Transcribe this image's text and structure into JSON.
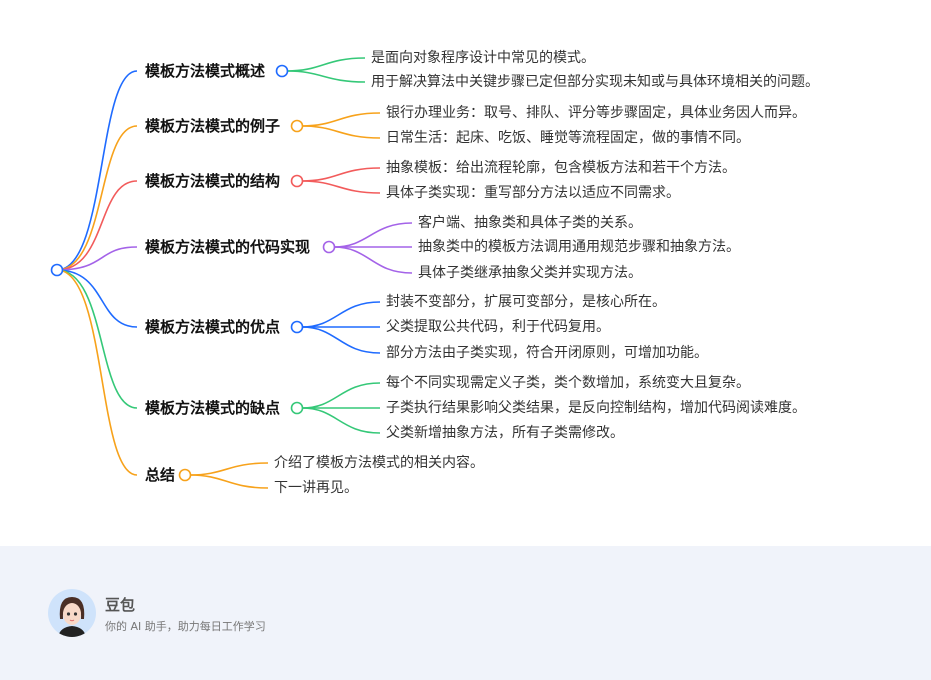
{
  "colors": {
    "blue": "#1f6bff",
    "orange": "#f7a21b",
    "red": "#f25b5b",
    "purple": "#a463e8",
    "green": "#35c878"
  },
  "branches": [
    {
      "label": "模板方法模式概述",
      "color": "blue",
      "leafColor": "green",
      "leaves": [
        "是面向对象程序设计中常见的模式。",
        "用于解决算法中关键步骤已定但部分实现未知或与具体环境相关的问题。"
      ]
    },
    {
      "label": "模板方法模式的例子",
      "color": "orange",
      "leafColor": "orange",
      "leaves": [
        "银行办理业务：取号、排队、评分等步骤固定，具体业务因人而异。",
        "日常生活：起床、吃饭、睡觉等流程固定，做的事情不同。"
      ]
    },
    {
      "label": "模板方法模式的结构",
      "color": "red",
      "leafColor": "red",
      "leaves": [
        "抽象模板：给出流程轮廓，包含模板方法和若干个方法。",
        "具体子类实现：重写部分方法以适应不同需求。"
      ]
    },
    {
      "label": "模板方法模式的代码实现",
      "color": "purple",
      "leafColor": "purple",
      "leaves": [
        "客户端、抽象类和具体子类的关系。",
        "抽象类中的模板方法调用通用规范步骤和抽象方法。",
        "具体子类继承抽象父类并实现方法。"
      ]
    },
    {
      "label": "模板方法模式的优点",
      "color": "blue",
      "leafColor": "blue",
      "leaves": [
        "封装不变部分，扩展可变部分，是核心所在。",
        "父类提取公共代码，利于代码复用。",
        "部分方法由子类实现，符合开闭原则，可增加功能。"
      ]
    },
    {
      "label": "模板方法模式的缺点",
      "color": "green",
      "leafColor": "green",
      "leaves": [
        "每个不同实现需定义子类，类个数增加，系统变大且复杂。",
        "子类执行结果影响父类结果，是反向控制结构，增加代码阅读难度。",
        "父类新增抽象方法，所有子类需修改。"
      ]
    },
    {
      "label": "总结",
      "color": "orange",
      "leafColor": "orange",
      "leaves": [
        "介绍了模板方法模式的相关内容。",
        "下一讲再见。"
      ]
    }
  ],
  "footer": {
    "brand": "豆包",
    "tagline": "你的 AI 助手，助力每日工作学习"
  }
}
